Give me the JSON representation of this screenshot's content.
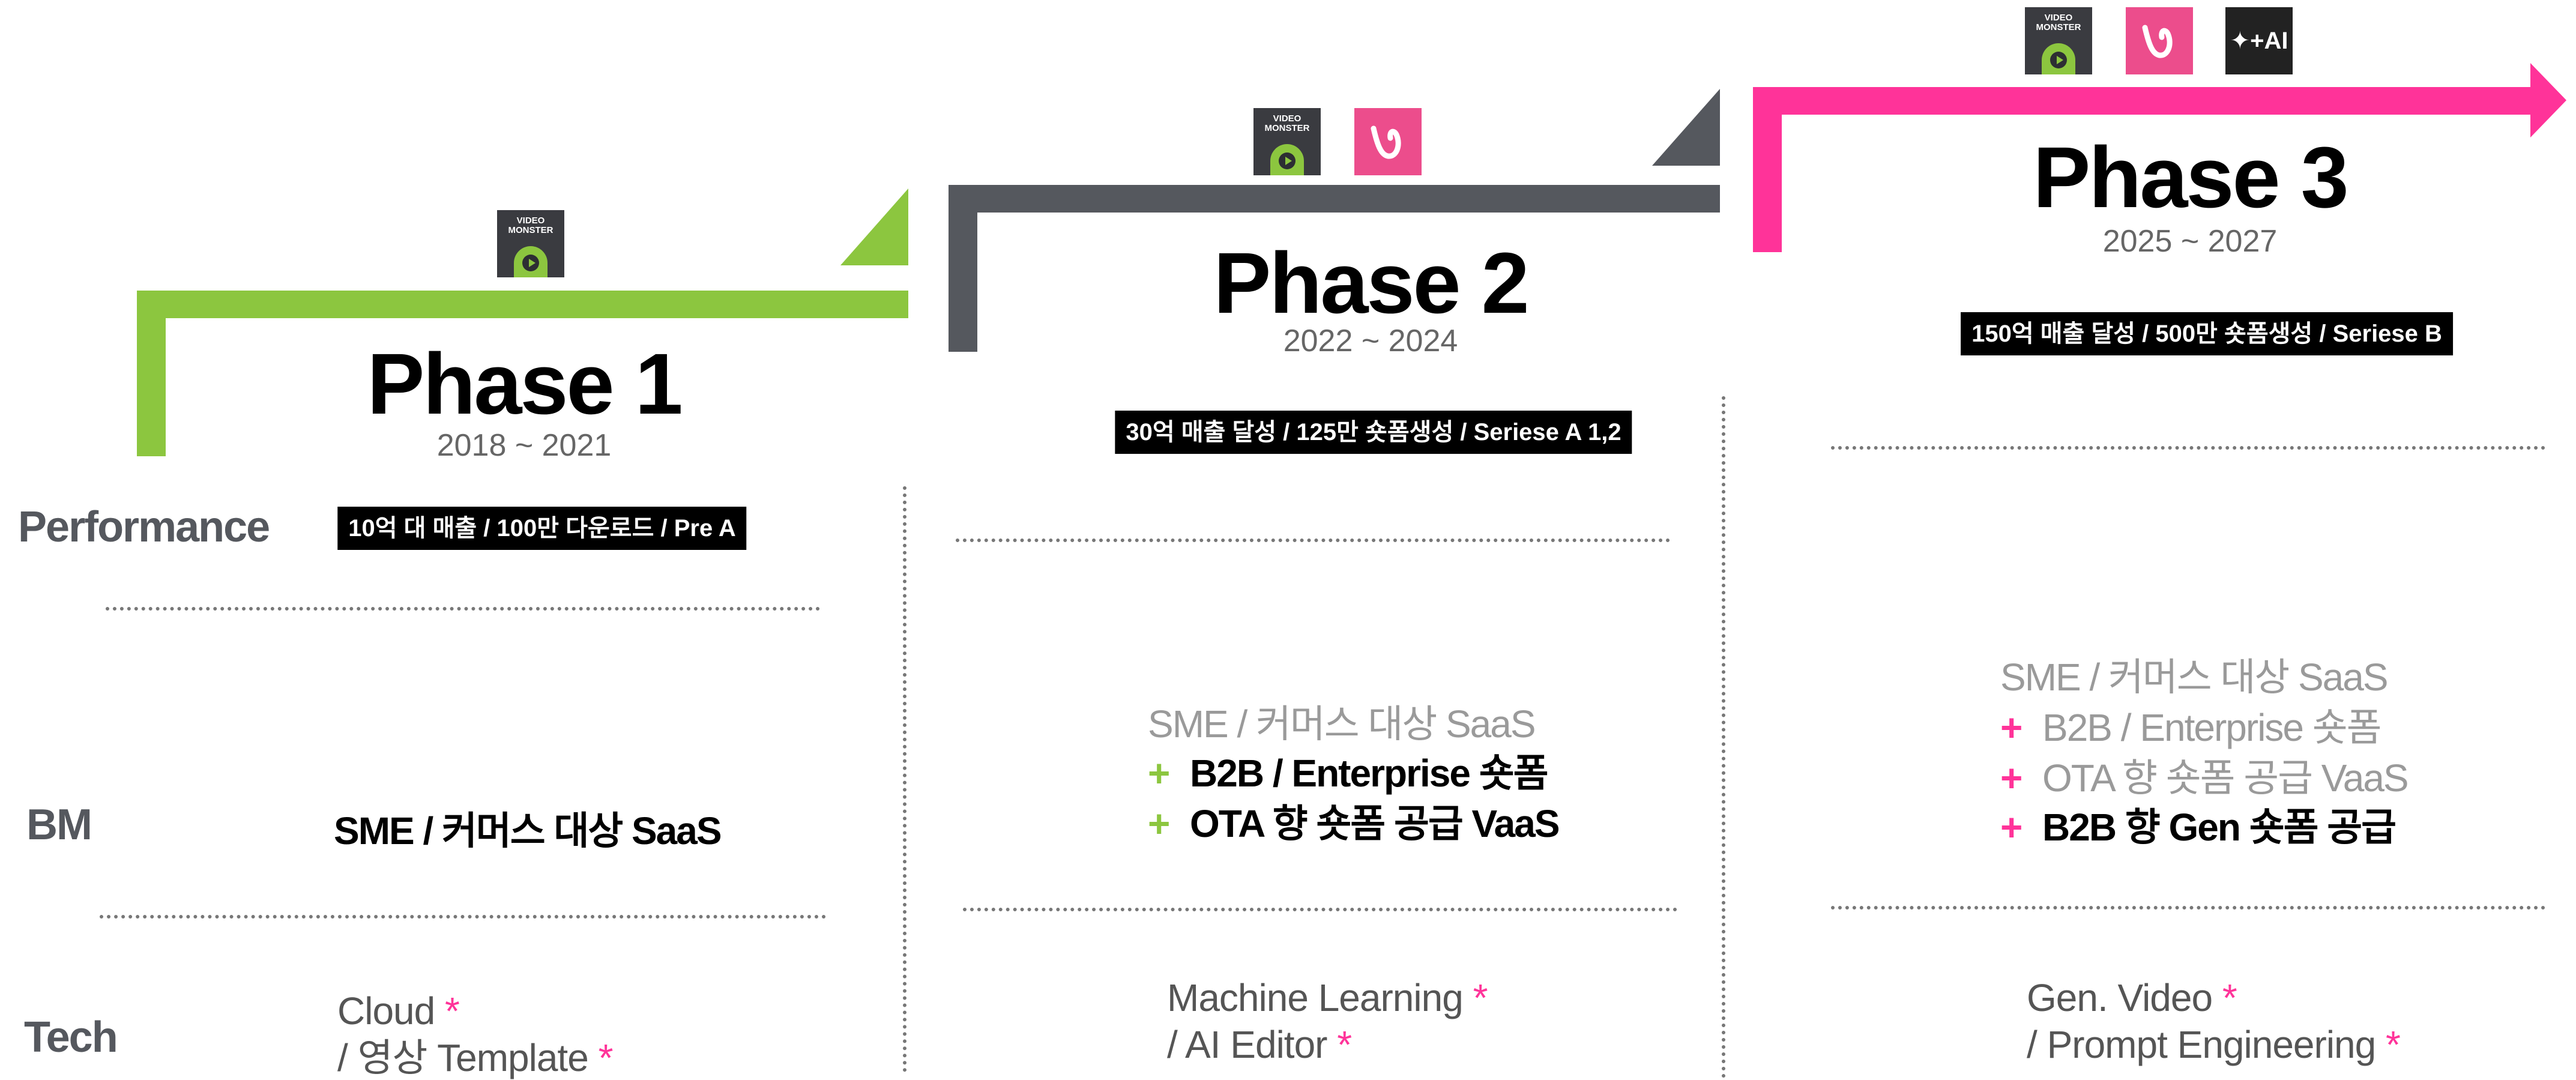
{
  "colors": {
    "phase1": "#8cc63f",
    "phase2": "#55585e",
    "phase3": "#ff3399",
    "asterisk": "#ff3399"
  },
  "logos": {
    "video_monster": "VIDEO MONSTER",
    "v_app": "v-logo",
    "ai": "✦+AI"
  },
  "row_labels": {
    "performance": "Performance",
    "bm": "BM",
    "tech": "Tech"
  },
  "phases": [
    {
      "title": "Phase 1",
      "years": "2018 ~ 2021",
      "performance": "10억 대 매출  / 100만 다운로드 / Pre A",
      "bm": [
        {
          "prefix": "",
          "text": "SME / 커머스 대상 SaaS"
        }
      ],
      "tech": [
        {
          "text": "Cloud ",
          "star": "*"
        },
        {
          "text": "/ 영상 Template ",
          "star": "*"
        }
      ]
    },
    {
      "title": "Phase 2",
      "years": "2022 ~ 2024",
      "performance": "30억 매출 달성 / 125만 숏폼생성 / Seriese A 1,2",
      "bm": [
        {
          "prefix": "",
          "text": "SME / 커머스 대상 SaaS"
        },
        {
          "prefix": "+",
          "text": "B2B / Enterprise 숏폼"
        },
        {
          "prefix": "+",
          "text": "OTA 향 숏폼 공급 VaaS"
        }
      ],
      "tech": [
        {
          "text": "Machine Learning ",
          "star": "*"
        },
        {
          "text": "/ AI Editor ",
          "star": "*"
        }
      ]
    },
    {
      "title": "Phase 3",
      "years": "2025 ~ 2027",
      "performance": "150억 매출 달성 / 500만 숏폼생성 / Seriese B",
      "bm": [
        {
          "prefix": "",
          "text": "SME / 커머스 대상 SaaS"
        },
        {
          "prefix": "+",
          "text": "B2B / Enterprise 숏폼"
        },
        {
          "prefix": "+",
          "text": "OTA 향 숏폼 공급 VaaS"
        },
        {
          "prefix": "+",
          "text": "B2B 향 Gen 숏폼 공급"
        }
      ],
      "tech": [
        {
          "text": "Gen. Video ",
          "star": "*"
        },
        {
          "text": "/ Prompt Engineering ",
          "star": "*"
        }
      ]
    }
  ]
}
